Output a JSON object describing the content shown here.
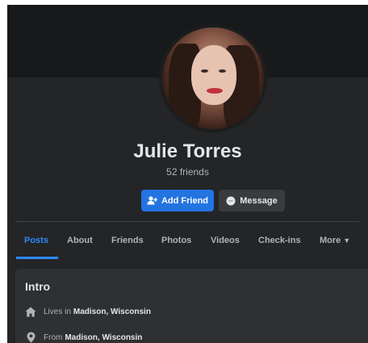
{
  "profile": {
    "name": "Julie Torres",
    "friends": "52 friends"
  },
  "actions": {
    "add_friend": "Add Friend",
    "message": "Message"
  },
  "tabs": [
    {
      "label": "Posts",
      "active": true
    },
    {
      "label": "About"
    },
    {
      "label": "Friends"
    },
    {
      "label": "Photos"
    },
    {
      "label": "Videos"
    },
    {
      "label": "Check-ins"
    },
    {
      "label": "More"
    }
  ],
  "intro": {
    "title": "Intro",
    "lives_prefix": "Lives in",
    "lives_value": "Madison, Wisconsin",
    "from_prefix": "From",
    "from_value": "Madison, Wisconsin"
  },
  "icons": {
    "add_friend": "person-plus-icon",
    "message": "messenger-icon",
    "more": "caret-down-icon",
    "lives": "home-icon",
    "from": "location-pin-icon"
  },
  "colors": {
    "background": "#242526",
    "accent": "#2d88ff",
    "add_button": "#2374e1"
  }
}
